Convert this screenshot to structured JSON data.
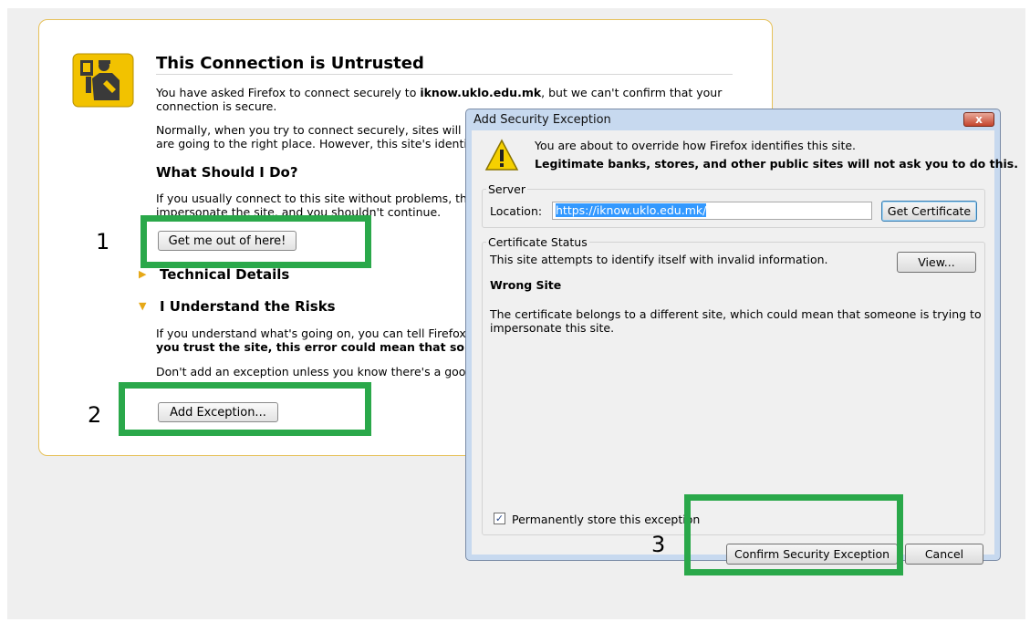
{
  "page": {
    "title": "This Connection is Untrusted",
    "intro_prefix": "You have asked Firefox to connect securely to ",
    "intro_host": "iknow.uklo.edu.mk",
    "intro_suffix": ", but we can't confirm that your",
    "intro_line2": "connection is secure.",
    "normally_line1": "Normally, when you try to connect securely, sites will p",
    "normally_line2": "are going to the right place. However, this site's identity",
    "what_heading": "What Should I Do?",
    "usually_line1": "If you usually connect to this site without problems, thi",
    "usually_line2": "impersonate the site, and you shouldn't continue.",
    "get_out_button": "Get me out of here!",
    "technical_details": "Technical Details",
    "understand_heading": "I Understand the Risks",
    "understand_line1": "If you understand what's going on, you can tell Firefox t",
    "understand_line2": "you trust the site, this error could mean that someon",
    "dont_add_line1": "Don't add an exception unless you know there's a good",
    "add_exception_button": "Add Exception..."
  },
  "dialog": {
    "title": "Add Security Exception",
    "close_label": "x",
    "warning_line1": "You are about to override how Firefox identifies this site.",
    "warning_line2": "Legitimate banks, stores, and other public sites will not ask you to do this.",
    "server_legend": "Server",
    "location_label": "Location:",
    "location_value": "https://iknow.uklo.edu.mk/",
    "get_certificate_button": "Get Certificate",
    "cert_status_legend": "Certificate Status",
    "status_text": "This site attempts to identify itself with invalid information.",
    "view_button": "View...",
    "wrong_site_heading": "Wrong Site",
    "wrong_site_line1": "The certificate belongs to a different site, which could mean that someone is trying to",
    "wrong_site_line2": "impersonate this site.",
    "permanently_store_label": "Permanently store this exception",
    "permanently_store_checked": true,
    "confirm_button": "Confirm Security Exception",
    "cancel_button": "Cancel"
  },
  "annotations": {
    "step1": "1",
    "step2": "2",
    "step3": "3",
    "highlight_color": "#2aa84a"
  }
}
